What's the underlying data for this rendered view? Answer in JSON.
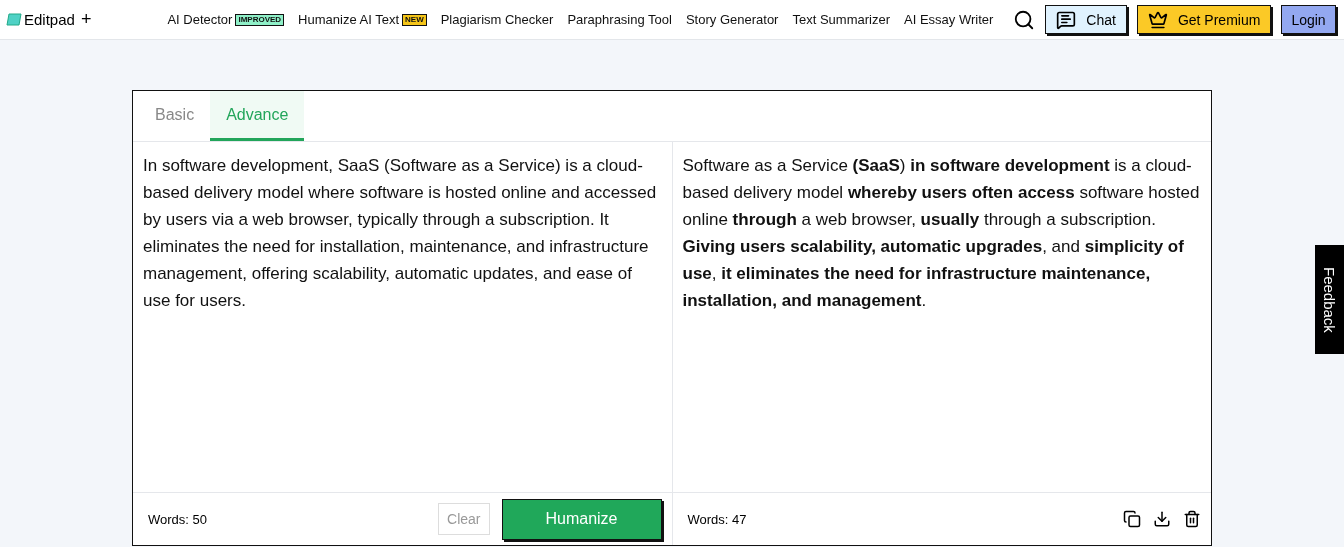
{
  "brand": {
    "name": "Editpad",
    "plus": "+"
  },
  "nav": [
    {
      "label": "AI Detector",
      "badge": {
        "text": "IMPROVED",
        "color": "#8ff0c8"
      }
    },
    {
      "label": "Humanize AI Text",
      "badge": {
        "text": "NEW",
        "color": "#f5c518"
      }
    },
    {
      "label": "Plagiarism Checker"
    },
    {
      "label": "Paraphrasing Tool"
    },
    {
      "label": "Story Generator"
    },
    {
      "label": "Text Summarizer"
    },
    {
      "label": "AI Essay Writer"
    }
  ],
  "actions": [
    {
      "kind": "chat",
      "label": "Chat"
    },
    {
      "kind": "premium",
      "label": "Get Premium"
    },
    {
      "kind": "login",
      "label": "Login"
    }
  ],
  "tabs": [
    {
      "label": "Basic",
      "selected": false
    },
    {
      "label": "Advance",
      "selected": true
    }
  ],
  "input": {
    "text": "In software development, SaaS (Software as a Service) is a cloud-based delivery model where software is hosted online and accessed by users via a web browser, typically through a subscription. It eliminates the need for installation, maintenance, and infrastructure management, offering scalability, automatic updates, and ease of use for users.",
    "words": "Words: 50",
    "clear": "Clear",
    "submit": "Humanize"
  },
  "output": {
    "text": "Software as a Service **(SaaS**) **in software development** is a cloud-based delivery model **whereby users often access** software hosted online **through** a web browser, **usually** through a subscription. **Giving users scalability, automatic upgrades**, and **simplicity of use**, **it eliminates the need for infrastructure maintenance, installation, and management**.",
    "words": "Words: 47"
  },
  "feedback": "Feedback"
}
